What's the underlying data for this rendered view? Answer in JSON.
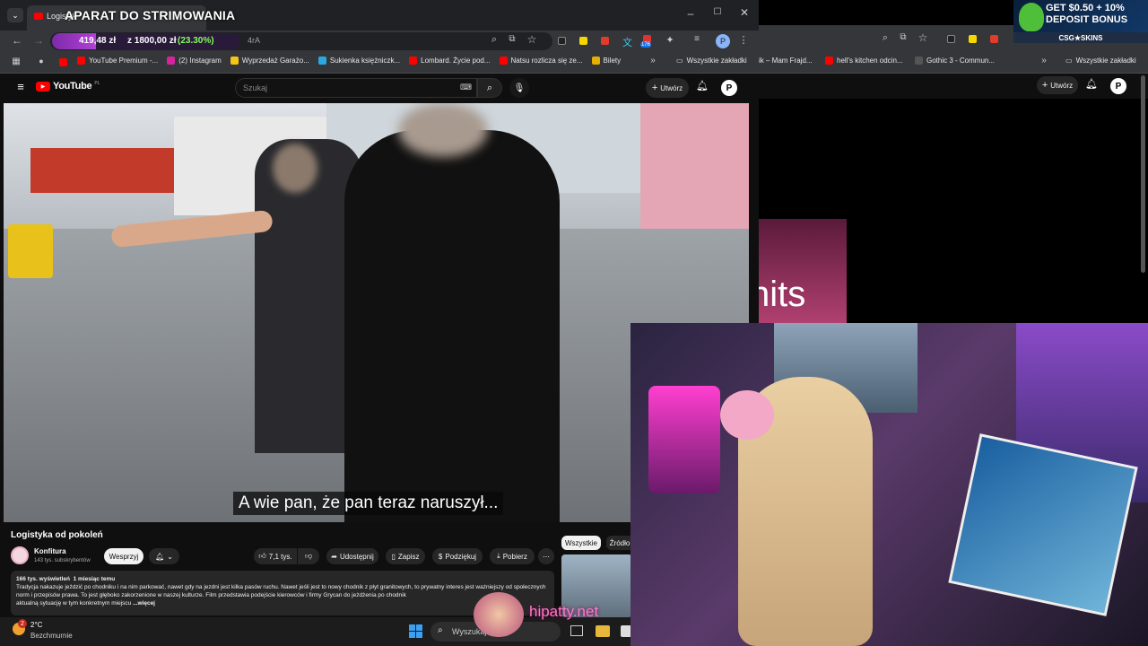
{
  "overlay": {
    "stream_title": "APARAT DO STRIMOWANIA",
    "donation_amount": "419,48 zł",
    "donation_goal": "z 1800,00 zł",
    "donation_percent": "(23.30%)",
    "donation_progress": 0.233,
    "url_fragment": "4rA",
    "watermark": "hipatty.net"
  },
  "browser_left": {
    "tab_title": "Logistyk",
    "bookmarks": [
      {
        "label": "YouTube Premium -...",
        "color": "#ff0000"
      },
      {
        "label": "(2) Instagram",
        "color": "#d6249f"
      },
      {
        "label": "Wyprzedaż Garażo...",
        "color": "#f5c518"
      },
      {
        "label": "Sukienka księżniczk...",
        "color": "#2aa9e0"
      },
      {
        "label": "Lombard. Życie pod...",
        "color": "#ff0000"
      },
      {
        "label": "Natsu rozlicza się ze...",
        "color": "#ff0000"
      },
      {
        "label": "Bilety",
        "color": "#e6b000"
      }
    ],
    "all_bookmarks": "Wszystkie zakładki",
    "extension_badge": "176",
    "profile_letter": "P"
  },
  "youtube": {
    "logo": "YouTube",
    "logo_region": "PL",
    "search_placeholder": "Szukaj",
    "create_label": "Utwórz",
    "subtitle": "A wie pan, że pan teraz naruszył...",
    "video_title": "Logistyka od pokoleń",
    "channel_name": "Konfitura",
    "subscribers": "143 tys. subskrybentów",
    "support_label": "Wesprzyj",
    "likes": "7,1 tys.",
    "share_label": "Udostępnij",
    "save_label": "Zapisz",
    "thanks_label": "Podziękuj",
    "download_label": "Pobierz",
    "views": "166 tys. wyświetleń",
    "published": "1 miesiąc temu",
    "description": "Tradycja nakazuje jeździć po chodniku i na nim parkować, nawet gdy na jezdni jest kilka pasów ruchu. Nawet jeśli jest to nowy chodnik z płyt granitowych, to prywatny interes jest ważniejszy od społecznych norm i przepisów prawa. To jest głęboko zakorzenione w naszej kulturze. Film przedstawia podejście kierowców i firmy Grycan do jeżdżenia po chodnik",
    "description_tail": "aktualną sytuację w tym konkretnym miejscu",
    "more_label": "...więcej",
    "filter_all": "Wszystkie",
    "filter_source": "Źródło"
  },
  "browser_right": {
    "bookmarks": [
      "ik – Mam Frajd...",
      "hell's kitchen odcin...",
      "Gothic 3 - Commun..."
    ],
    "all_bookmarks": "Wszystkie zakładki",
    "create_label": "Utwórz",
    "thumb_text": "hits"
  },
  "ad": {
    "line1": "GET $0.50 + 10%",
    "line2": "DEPOSIT BONUS",
    "brand": "CSG★SKINS"
  },
  "taskbar": {
    "temperature": "2°C",
    "weather": "Bezchmurnie",
    "search_placeholder": "Wyszukaj",
    "notification_count": "2"
  }
}
